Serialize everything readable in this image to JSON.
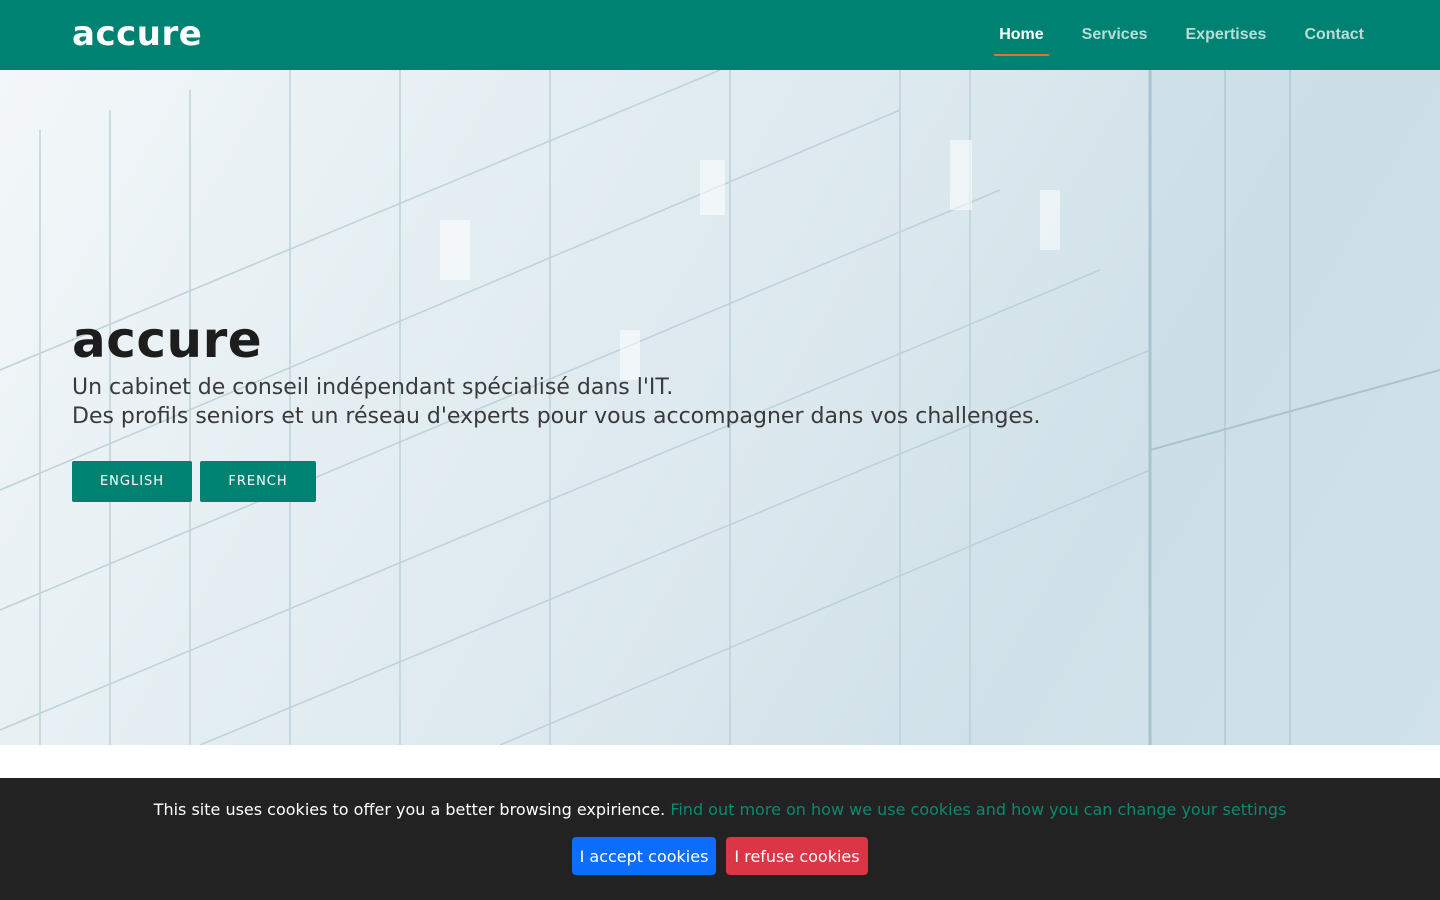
{
  "header": {
    "logo": "accure",
    "nav": [
      {
        "label": "Home",
        "active": true
      },
      {
        "label": "Services",
        "active": false
      },
      {
        "label": "Expertises",
        "active": false
      },
      {
        "label": "Contact",
        "active": false
      }
    ]
  },
  "hero": {
    "title": "accure",
    "subtitle_line1": "Un cabinet de conseil indépendant spécialisé dans l'IT.",
    "subtitle_line2": "Des profils seniors et un réseau d'experts pour vous accompagner dans vos challenges.",
    "buttons": {
      "english": "ENGLISH",
      "french": "FRENCH"
    }
  },
  "cookie": {
    "text": "This site uses cookies to offer you a better browsing expirience.",
    "link": "Find out more on how we use cookies and how you can change your settings",
    "accept": "I accept cookies",
    "refuse": "I refuse cookies"
  },
  "colors": {
    "brand": "#008272",
    "active_underline": "#e0733a",
    "accept": "#0d6efd",
    "refuse": "#dc3545",
    "cookie_bg": "#222222"
  }
}
